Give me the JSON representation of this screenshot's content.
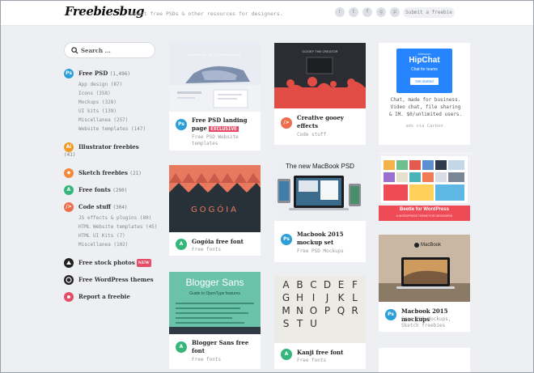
{
  "header": {
    "logo": "Freebiesbug",
    "tagline": "Latest free PSDs & other resources for designers.",
    "social_icons": [
      "rss-icon",
      "twitter-icon",
      "facebook-icon",
      "google-plus-icon",
      "pinterest-icon"
    ],
    "social_glyphs": [
      "r",
      "t",
      "f",
      "g",
      "p"
    ],
    "submit_label": "Submit a freebie"
  },
  "sidebar": {
    "search_placeholder": "Search ...",
    "categories": [
      {
        "label": "Free PSD",
        "count": "(1,496)",
        "icon": "Ps",
        "subs": [
          "App design (87)",
          "Icons (358)",
          "Mockups (328)",
          "UI kits (139)",
          "Miscellanea (257)",
          "Website templates (147)"
        ]
      },
      {
        "label": "Illustrator freebies",
        "count": "(41)",
        "icon": "Ai"
      },
      {
        "label": "Sketch freebies",
        "count": "(21)",
        "icon": "◆"
      },
      {
        "label": "Free fonts",
        "count": "(290)",
        "icon": "A"
      },
      {
        "label": "Code stuff",
        "count": "(304)",
        "icon": "/>",
        "subs": [
          "JS effects & plugins (80)",
          "HTML Website templates (45)",
          "HTML UI Kits (7)",
          "Miscellanea (102)"
        ]
      }
    ],
    "extras": [
      {
        "label": "Free stock photos",
        "badge": "NEW"
      },
      {
        "label": "Free WordPress themes"
      },
      {
        "label": "Report a freebie"
      }
    ]
  },
  "cards": {
    "c1": {
      "title": "Free PSD landing page",
      "badge": "EXCLUSIVE",
      "sub": "Free PSD Website templates",
      "icon": "Ps",
      "thumb_text": "WORKING WITH BROCHURE"
    },
    "c2": {
      "title": "Creative gooey effects",
      "sub": "Code stuff",
      "icon": "/>",
      "thumb_text": "GOOEY THE CREATOR"
    },
    "c3": {
      "title": "Gogóia free font",
      "sub": "Free fonts",
      "icon": "A",
      "thumb_text": "GOGÓIA"
    },
    "c4": {
      "title": "Macbook 2015 mockup set",
      "sub": "Free PSD Mockups",
      "icon": "Ps",
      "thumb_text": "The new MacBook PSD"
    },
    "c5": {
      "title": "Blogger Sans free font",
      "sub": "Free fonts",
      "icon": "A",
      "thumb_text": "Blogger Sans",
      "thumb_sub": "Guide to OpenType features"
    },
    "c6": {
      "title": "Kanji free font",
      "sub": "Free fonts",
      "icon": "A",
      "thumb_letters": [
        "A",
        "B",
        "C",
        "D",
        "E",
        "F",
        "G",
        "H",
        "I",
        "J",
        "K",
        "L",
        "M",
        "N",
        "O",
        "P",
        "Q",
        "R",
        "S",
        "T",
        "U"
      ]
    },
    "ad": {
      "brand": "HipChat",
      "brand_top": "Atlassian",
      "tag": "Chat for teams",
      "cta": "Get started",
      "text": "Chat, made for business. Video chat, file sharing & IM. $0/unlimited users.",
      "via": "ads via Carbon"
    },
    "c7": {
      "thumb_text": "Beetle for WordPress",
      "thumb_sub": "A WORDPRESS THEME FOR DESIGNERS"
    },
    "c8": {
      "title": "Macbook 2015 mockups",
      "sub": "Free PSD Mockups, Sketch freebies",
      "icon": "Ps",
      "thumb_text": "MacBook"
    }
  },
  "colors": {
    "ps": "#2c9fd9",
    "ai": "#f29a24",
    "sketch": "#f28a3a",
    "font": "#35b67c",
    "code": "#ee6d4c",
    "accent_red": "#e64c65"
  }
}
